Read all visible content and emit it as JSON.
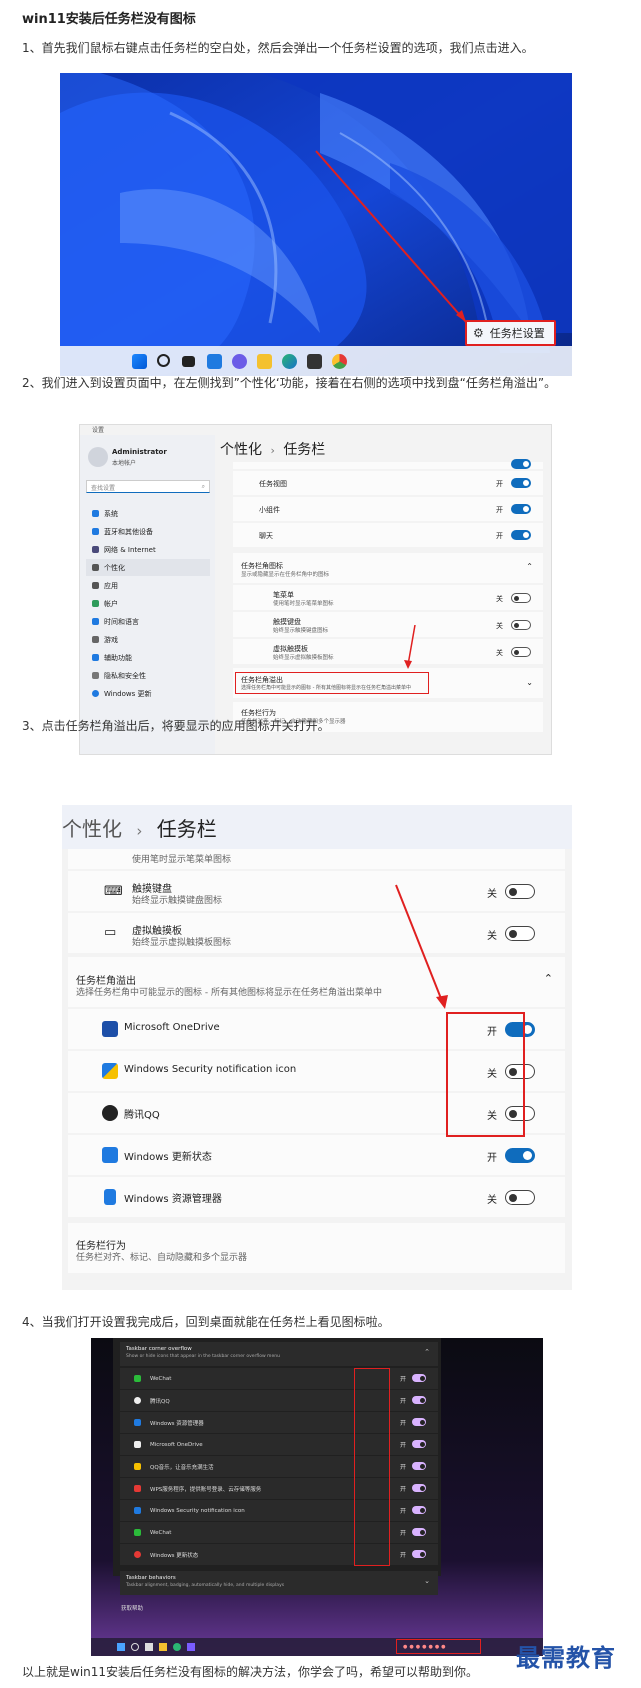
{
  "article": {
    "title": "win11安装后任务栏没有图标",
    "step1": "1、首先我们鼠标右键点击任务栏的空白处，然后会弹出一个任务栏设置的选项，我们点击进入。",
    "step2": "2、我们进入到设置页面中，在左侧找到”个性化‘功能，接着在右侧的选项中找到盘“任务栏角溢出”。",
    "step3": "3、点击任务栏角溢出后，将要显示的应用图标开关打开。",
    "step4": "4、当我们打开设置我完成后，回到桌面就能在任务栏上看见图标啦。",
    "footer": "以上就是win11安装后任务栏没有图标的解决方法，你学会了吗，希望可以帮助到你。",
    "watermark": "最需教育"
  },
  "fig1": {
    "callout_label": "任务栏设置",
    "taskbar_icons": [
      "windows-start-icon",
      "search-icon",
      "task-view-icon",
      "widgets-icon",
      "chat-icon",
      "file-explorer-icon",
      "edge-icon",
      "store-icon",
      "chrome-icon"
    ]
  },
  "fig2": {
    "user_name": "Administrator",
    "user_sub": "本地帐户",
    "search_placeholder": "查找设置",
    "nav": [
      "系统",
      "蓝牙和其他设备",
      "网络 & Internet",
      "个性化",
      "应用",
      "帐户",
      "时间和语言",
      "游戏",
      "辅助功能",
      "隐私和安全性",
      "Windows 更新"
    ],
    "breadcrumb_parent": "个性化",
    "breadcrumb_sep": "›",
    "breadcrumb_current": "任务栏",
    "items": [
      {
        "label": "任务视图",
        "state": "开"
      },
      {
        "label": "小组件",
        "state": "开"
      },
      {
        "label": "聊天",
        "state": "开"
      }
    ],
    "corner_icons_title": "任务栏角图标",
    "corner_icons_sub": "显示或隐藏显示在任务栏角中的图标",
    "corner_items": [
      {
        "label": "笔菜单",
        "sub": "使用笔时显示笔菜单图标",
        "state": "关"
      },
      {
        "label": "触摸键盘",
        "sub": "始终显示触摸键盘图标",
        "state": "关"
      },
      {
        "label": "虚拟触摸板",
        "sub": "始终显示虚拟触摸板图标",
        "state": "关"
      }
    ],
    "overflow_title": "任务栏角溢出",
    "overflow_sub": "选择任务栏角中可能显示的图标 - 所有其他图标将显示在任务栏角溢出菜单中",
    "behavior_title": "任务栏行为",
    "behavior_sub": "任务栏对齐、标记、自动隐藏和多个显示器"
  },
  "fig3": {
    "breadcrumb_parent": "个性化",
    "breadcrumb_sep": "›",
    "breadcrumb_current": "任务栏",
    "top_partial_sub": "使用笔时显示笔菜单图标",
    "corner_items": [
      {
        "label": "触摸键盘",
        "sub": "始终显示触摸键盘图标",
        "state": "关"
      },
      {
        "label": "虚拟触摸板",
        "sub": "始终显示虚拟触摸板图标",
        "state": "关"
      }
    ],
    "overflow_title": "任务栏角溢出",
    "overflow_sub": "选择任务栏角中可能显示的图标 - 所有其他图标将显示在任务栏角溢出菜单中",
    "apps": [
      {
        "label": "Microsoft OneDrive",
        "state": "开",
        "on": true
      },
      {
        "label": "Windows Security notification icon",
        "state": "关",
        "on": false
      },
      {
        "label": "腾讯QQ",
        "state": "关",
        "on": false
      },
      {
        "label": "Windows 更新状态",
        "state": "开",
        "on": true
      },
      {
        "label": "Windows 资源管理器",
        "state": "关",
        "on": false
      }
    ],
    "behavior_title": "任务栏行为",
    "behavior_sub": "任务栏对齐、标记、自动隐藏和多个显示器"
  },
  "fig4": {
    "header_title": "Taskbar corner overflow",
    "header_sub": "Show or hide icons that appear in the taskbar corner overflow menu",
    "apps": [
      "WeChat",
      "腾讯QQ",
      "Windows 资源管理器",
      "Microsoft OneDrive",
      "QQ音乐，让音乐充满生活",
      "WPS服务程序，提供账号登录、云存储等服务",
      "Windows Security notification icon",
      "WeChat",
      "Windows 更新状态"
    ],
    "state": "开",
    "behavior_title": "Taskbar behaviors",
    "behavior_sub": "Taskbar alignment, badging, automatically hide, and multiple displays",
    "help": "获取帮助"
  }
}
